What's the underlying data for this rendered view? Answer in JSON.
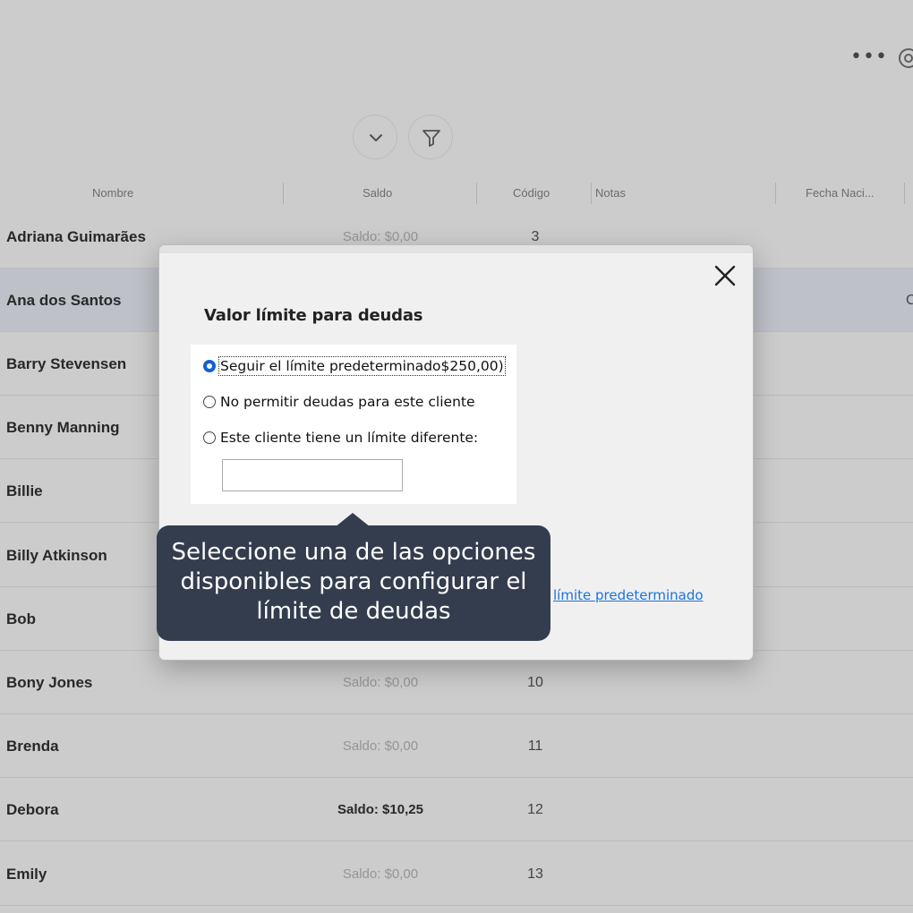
{
  "toolbar": {
    "more_icon": "ellipsis-icon",
    "settings_icon": "gear-icon",
    "chevron_icon": "chevron-down-icon",
    "filter_icon": "filter-icon"
  },
  "columns": [
    "Nombre",
    "Saldo",
    "Código",
    "Notas",
    "Fecha Naci..."
  ],
  "rows": [
    {
      "name": "Adriana Guimarães",
      "saldo": "Saldo: $0,00",
      "code": "3",
      "extra": ""
    },
    {
      "name": "Ana dos Santos",
      "saldo": "",
      "code": "",
      "extra": "C"
    },
    {
      "name": "Barry  Stevensen",
      "saldo": "",
      "code": "",
      "extra": ""
    },
    {
      "name": "Benny Manning",
      "saldo": "",
      "code": "",
      "extra": ""
    },
    {
      "name": "Billie",
      "saldo": "",
      "code": "",
      "extra": ""
    },
    {
      "name": "Billy Atkinson",
      "saldo": "",
      "code": "",
      "extra": ""
    },
    {
      "name": "Bob",
      "saldo": "",
      "code": "",
      "extra": ""
    },
    {
      "name": "Bony Jones",
      "saldo": "Saldo: $0,00",
      "code": "10",
      "extra": ""
    },
    {
      "name": "Brenda",
      "saldo": "Saldo: $0,00",
      "code": "11",
      "extra": ""
    },
    {
      "name": "Debora",
      "saldo": "Saldo: $10,25",
      "code": "12",
      "extra": ""
    },
    {
      "name": "Emily",
      "saldo": "Saldo: $0,00",
      "code": "13",
      "extra": ""
    }
  ],
  "dialog": {
    "title": "Valor límite para deudas",
    "close_icon": "close-icon",
    "options": [
      {
        "label": "Seguir el límite predeterminado$250,00)",
        "checked": true
      },
      {
        "label": "No permitir deudas para este cliente",
        "checked": false
      },
      {
        "label": "Este cliente tiene un límite diferente:",
        "checked": false
      }
    ],
    "custom_limit_value": "",
    "link_text": "límite predeterminado"
  },
  "tooltip": {
    "text": "Seleccione una de las opciones disponibles para configurar el límite de deudas"
  },
  "colors": {
    "accent": "#1160cf",
    "link": "#1a73d9",
    "tooltip_bg": "#333d4e",
    "overlay": "rgba(0,0,0,0.2)"
  }
}
